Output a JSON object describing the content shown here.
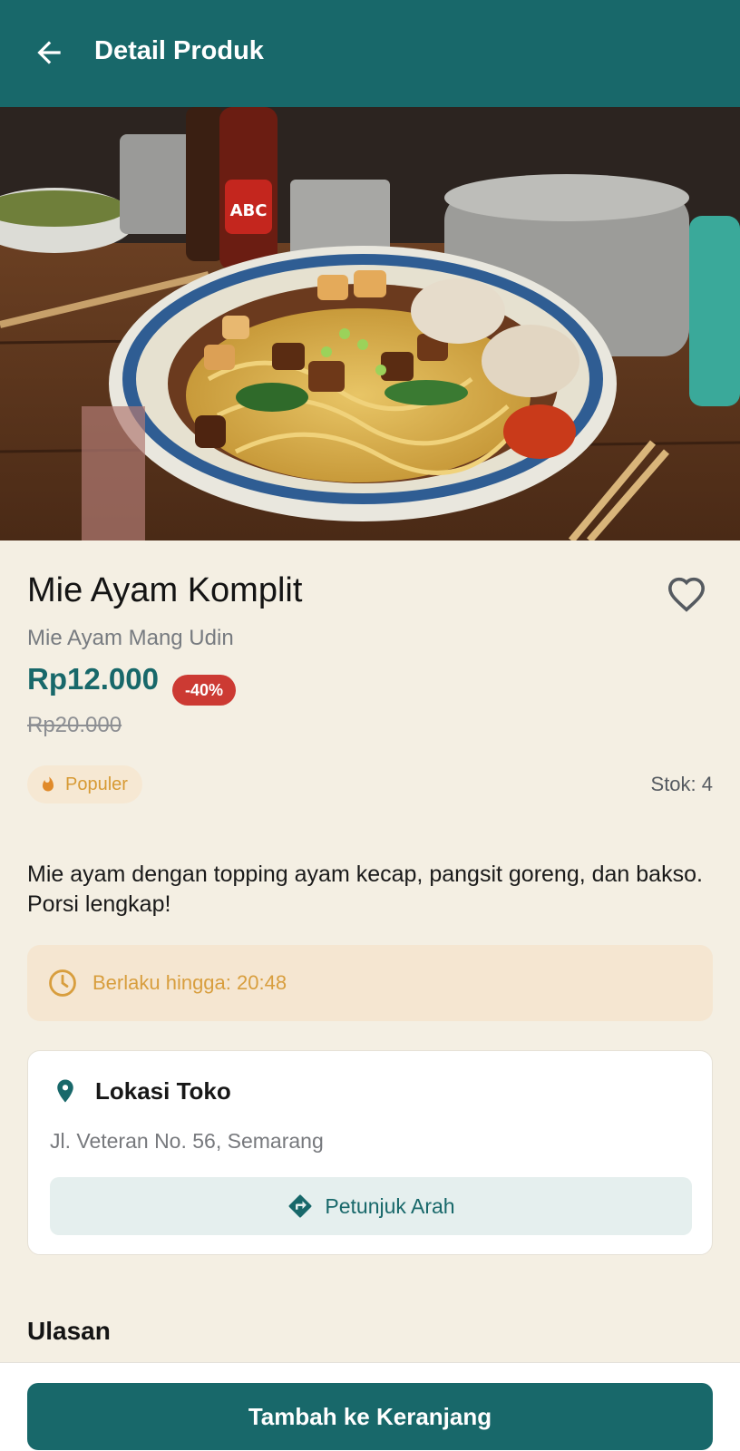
{
  "header": {
    "title": "Detail Produk",
    "back_icon": "arrow-left-icon",
    "background_color": "#18686a"
  },
  "hero_image": {
    "description_icon": "product-photo"
  },
  "product": {
    "name": "Mie Ayam Komplit",
    "shop": "Mie Ayam Mang Udin",
    "price": "Rp12.000",
    "discount": "-40%",
    "original_price": "Rp20.000",
    "badge": "Populer",
    "badge_icon": "flame-icon",
    "stock": "Stok: 4",
    "description": "Mie ayam dengan topping ayam kecap, pangsit goreng, dan bakso. Porsi lengkap!",
    "favorite_icon": "heart-outline-icon"
  },
  "validity": {
    "label": "Berlaku hingga: 20:48",
    "icon": "clock-icon"
  },
  "location": {
    "title": "Lokasi Toko",
    "icon": "location-pin-icon",
    "address": "Jl. Veteran No. 56, Semarang",
    "directions_label": "Petunjuk Arah",
    "directions_icon": "directions-icon"
  },
  "reviews": {
    "title": "Ulasan"
  },
  "footer": {
    "add_to_cart_label": "Tambah ke Keranjang"
  },
  "colors": {
    "primary": "#18686a",
    "discount": "#cc3a33",
    "accent_orange": "#d89e3e",
    "background": "#f4efe3"
  }
}
